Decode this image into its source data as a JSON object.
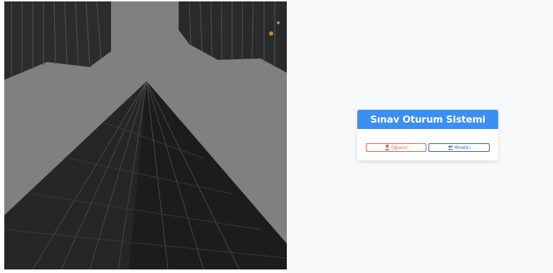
{
  "card": {
    "title": "Sınav Oturum Sistemi"
  },
  "buttons": {
    "student_label": "Öğrenci",
    "student_icon": "student-icon",
    "admin_label": "Yönetici",
    "admin_icon": "users-icon"
  },
  "colors": {
    "header_blue": "#3d8ef2",
    "student_red": "#e05a4f",
    "admin_blue": "#2f5fb8",
    "background": "#f8f9fb"
  }
}
